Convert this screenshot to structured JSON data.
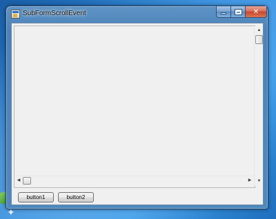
{
  "window": {
    "title": "SubFormScrollEvent"
  },
  "titlebar": {
    "icons": [
      "app-icon",
      "minimize-icon",
      "maximize-icon",
      "close-icon"
    ],
    "close_glyph": "✕"
  },
  "scrollbars": {
    "vertical": {
      "up_glyph": "▲",
      "down_glyph": "▼",
      "position": 0
    },
    "horizontal": {
      "left_glyph": "◀",
      "right_glyph": "▶",
      "position": 0
    }
  },
  "buttons": {
    "button1_label": "button1",
    "button2_label": "button2"
  },
  "colors": {
    "client_bg": "#f0f0f0",
    "close_button": "#c8452c",
    "titlebar": "#4a83ba"
  }
}
